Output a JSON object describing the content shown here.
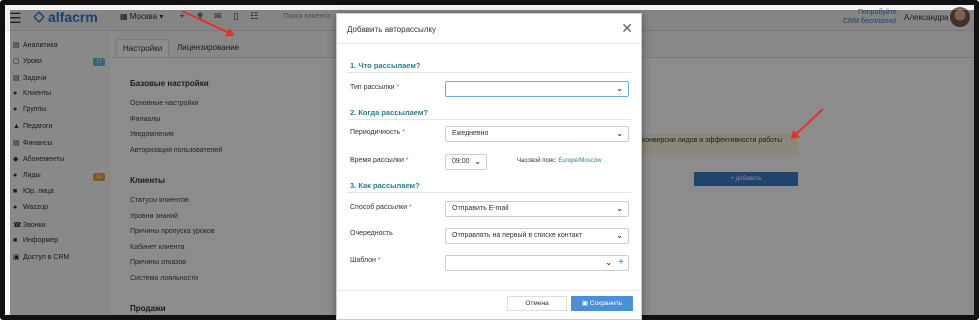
{
  "topbar": {
    "brand": "alfacrm",
    "branch": "Москва",
    "search_placeholder": "Поиск клиента",
    "promo_line1": "Попробуйте",
    "promo_line2": "CRM бесплатно!",
    "user_name": "Александра",
    "icons": [
      "plus-icon",
      "wrench-icon",
      "mail-icon",
      "mobile-icon",
      "cart-icon"
    ]
  },
  "sidebar": {
    "items": [
      {
        "label": "Аналитика",
        "icon": "chart-icon"
      },
      {
        "label": "Уроки",
        "icon": "calendar-icon",
        "badge": "17"
      },
      {
        "label": "Задачи",
        "icon": "tasks-icon"
      },
      {
        "label": "Клиенты",
        "icon": "user-icon"
      },
      {
        "label": "Группы",
        "icon": "group-icon"
      },
      {
        "label": "Педагоги",
        "icon": "graduation-icon"
      },
      {
        "label": "Финансы",
        "icon": "money-icon"
      },
      {
        "label": "Абонементы",
        "icon": "tag-icon"
      },
      {
        "label": "Лиды",
        "icon": "leads-icon",
        "badge": "11"
      },
      {
        "label": "Юр. лица",
        "icon": "briefcase-icon"
      },
      {
        "label": "Wazzup",
        "icon": "chat-icon"
      },
      {
        "label": "Звонки",
        "icon": "phone-icon"
      },
      {
        "label": "Информер",
        "icon": "informer-icon"
      },
      {
        "label": "Доступ в CRM",
        "icon": "lock-icon"
      }
    ]
  },
  "tabs": [
    "Настройки",
    "Лицензирование"
  ],
  "settings": {
    "base_title": "Базовые настройки",
    "base_links": [
      "Основные настройки",
      "Филиалы",
      "Уведомления",
      "Авторизация пользователей"
    ],
    "clients_title": "Клиенты",
    "clients_links": [
      "Статусы клиентов",
      "Уровни знаний",
      "Причины пропуска уроков",
      "Кабинет клиента",
      "Причины отказов",
      "Система лояльности"
    ],
    "sales_title": "Продажи",
    "hint_text": "конверсии лидов и эффективности работы",
    "add_button": "+ добавить"
  },
  "modal": {
    "title": "Добавить авторассылку",
    "step1": "1. Что рассылаем?",
    "step2": "2. Когда рассылаем?",
    "step3": "3. Как рассылаем?",
    "type_label": "Тип рассылки",
    "type_value": "",
    "periodicity_label": "Периодичность",
    "periodicity_value": "Ежедневно",
    "time_label": "Время рассылки",
    "time_value": "09:00",
    "timezone_label": "Часовой пояс:",
    "timezone_value": "Europe/Moscow",
    "method_label": "Способ рассылки",
    "method_value": "Отправить E-mail",
    "order_label": "Очередность",
    "order_value": "Отправлять на первый в списке контакт",
    "template_label": "Шаблон",
    "template_value": "",
    "required_mark": "*",
    "cancel": "Отмена",
    "save": "Сохранить"
  },
  "colors": {
    "accent": "#2c7ad6",
    "step": "#2b7c8c",
    "required": "#d9534f",
    "arrow": "#e0322e",
    "save_button": "#4a90d9"
  }
}
